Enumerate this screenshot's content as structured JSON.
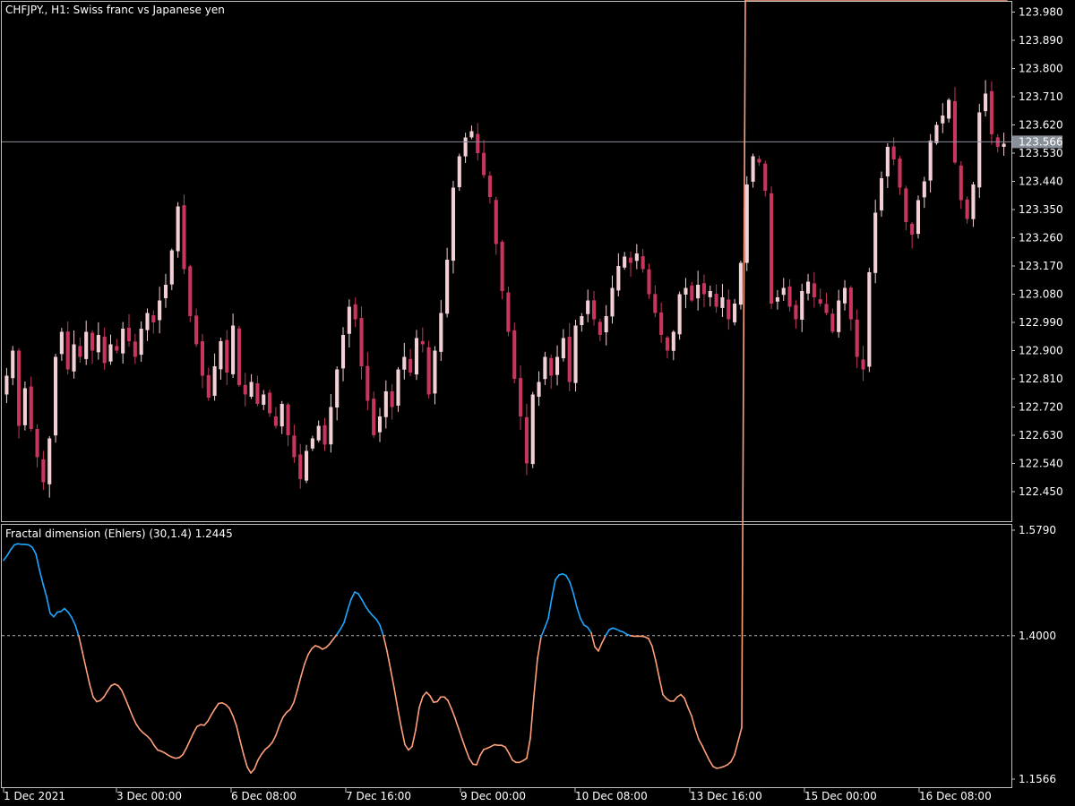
{
  "header": {
    "title": "CHFJPY., H1:  Swiss franc vs Japanese yen"
  },
  "indicator": {
    "title": "Fractal dimension (Ehlers) (30,1.4) 1.2445"
  },
  "colors": {
    "background": "#000000",
    "frame": "#c0c0c0",
    "bull_candle": "#f2d0d6",
    "bear_candle": "#c8365e",
    "price_line": "#8a9099",
    "price_label_bg": "#8a9099",
    "fd_above": "#1ea7ff",
    "fd_below": "#ff9f7a",
    "level_line": "#b8b8b8"
  },
  "chart_data": [
    {
      "type": "candlestick",
      "title": "CHFJPY., H1:  Swiss franc vs Japanese yen",
      "ylim": [
        122.39,
        123.99
      ],
      "y_ticks": [
        "123.980",
        "123.890",
        "123.800",
        "123.710",
        "123.620",
        "123.530",
        "123.440",
        "123.350",
        "123.260",
        "123.170",
        "123.080",
        "122.990",
        "122.900",
        "122.810",
        "122.720",
        "122.630",
        "122.540",
        "122.450"
      ],
      "current_price": "123.566",
      "x_ticks": [
        "1 Dec 2021",
        "3 Dec 00:00",
        "6 Dec 08:00",
        "7 Dec 16:00",
        "9 Dec 00:00",
        "10 Dec 08:00",
        "13 Dec 16:00",
        "15 Dec 00:00",
        "16 Dec 08:00"
      ],
      "closes": [
        122.82,
        122.9,
        122.66,
        122.78,
        122.65,
        122.56,
        122.48,
        122.62,
        122.88,
        122.96,
        122.84,
        122.92,
        122.88,
        122.96,
        122.9,
        122.95,
        122.86,
        122.92,
        122.9,
        122.97,
        122.93,
        122.88,
        122.97,
        123.02,
        122.99,
        123.06,
        123.11,
        123.22,
        123.36,
        123.16,
        123.01,
        122.92,
        122.82,
        122.75,
        122.85,
        122.93,
        122.83,
        122.98,
        122.79,
        122.76,
        122.8,
        122.73,
        122.76,
        122.7,
        122.66,
        122.73,
        122.63,
        122.56,
        122.49,
        122.58,
        122.62,
        122.66,
        122.6,
        122.72,
        122.84,
        122.95,
        123.04,
        123.0,
        122.85,
        122.74,
        122.63,
        122.69,
        122.77,
        122.72,
        122.84,
        122.88,
        122.83,
        122.94,
        122.92,
        122.76,
        122.9,
        123.02,
        123.19,
        123.42,
        123.52,
        123.58,
        123.6,
        123.53,
        123.46,
        123.39,
        123.24,
        123.09,
        122.96,
        122.81,
        122.69,
        122.54,
        122.76,
        122.8,
        122.88,
        122.82,
        122.88,
        122.94,
        122.8,
        122.98,
        123.01,
        123.06,
        123.0,
        122.95,
        123.01,
        123.1,
        123.17,
        123.2,
        123.18,
        123.21,
        123.16,
        123.08,
        123.02,
        122.95,
        122.9,
        122.96,
        123.08,
        123.1,
        123.06,
        123.11,
        123.08,
        123.09,
        123.04,
        123.07,
        123.0,
        123.05,
        123.18,
        123.43,
        123.52,
        123.5,
        123.41,
        123.05,
        123.07,
        123.1,
        123.04,
        123.0,
        123.09,
        123.12,
        123.07,
        123.05,
        123.02,
        122.96,
        123.06,
        123.1,
        123.0,
        122.88,
        122.84,
        123.15,
        123.34,
        123.45,
        123.55,
        123.51,
        123.42,
        123.31,
        123.27,
        123.38,
        123.44,
        123.57,
        123.62,
        123.65,
        123.7,
        123.5,
        123.38,
        123.32,
        123.43,
        123.66,
        123.72,
        123.59,
        123.55,
        123.56
      ],
      "panel": "main"
    },
    {
      "type": "line",
      "title": "Fractal dimension (Ehlers) (30,1.4) 1.2445",
      "ylim": [
        1.1566,
        1.579
      ],
      "y_ticks": [
        "1.5790",
        "1.4000",
        "1.1566"
      ],
      "level": 1.4,
      "current_value": 1.2445,
      "x": [
        0,
        4,
        8,
        12,
        16,
        20,
        24,
        28,
        32,
        36,
        40,
        44,
        48,
        52,
        56,
        60,
        64,
        68,
        72,
        76,
        80,
        84,
        88,
        92,
        96,
        100,
        104,
        108,
        112,
        116,
        120,
        124,
        128,
        132,
        136,
        140,
        144,
        148,
        152,
        156,
        160,
        164,
        168,
        172,
        176,
        180,
        184,
        188,
        192,
        196,
        200,
        204,
        208,
        212,
        216,
        220,
        224,
        228,
        232,
        236,
        240,
        244,
        248,
        252,
        256,
        260,
        264,
        268,
        272,
        276,
        280,
        284,
        288,
        292,
        296,
        300,
        304,
        308,
        312,
        316,
        320,
        324,
        328,
        332,
        336,
        340,
        344,
        348,
        352,
        356,
        360,
        364,
        368,
        372,
        376,
        380,
        384,
        388,
        392,
        396,
        400,
        404,
        408,
        412,
        416,
        420,
        424,
        428,
        432,
        436,
        440,
        444,
        448,
        452,
        456,
        460,
        464,
        468,
        472,
        476,
        480,
        484,
        488,
        492,
        496,
        500,
        504,
        508,
        512,
        516,
        520,
        524,
        528,
        532,
        536,
        540,
        544,
        548,
        552,
        556,
        560,
        564,
        568,
        572,
        576,
        580,
        584,
        588,
        592,
        596,
        600,
        604,
        608,
        612,
        616,
        620,
        624,
        628,
        632,
        636,
        640,
        644,
        648,
        652,
        656,
        660,
        664,
        668,
        672,
        676,
        680,
        684,
        688,
        692,
        696,
        700,
        704,
        708,
        712,
        716,
        720,
        724,
        728,
        732,
        736,
        740,
        744,
        748,
        752,
        756,
        760,
        764,
        768,
        772,
        776,
        780,
        784,
        788,
        792,
        796,
        800,
        804,
        808,
        812,
        816,
        820,
        824,
        828,
        832,
        836,
        840,
        844,
        848,
        852,
        856,
        860,
        864,
        868,
        872,
        876,
        880,
        884,
        888,
        892,
        896,
        900,
        904,
        908,
        912,
        916,
        920,
        924,
        928,
        932,
        936,
        940,
        944,
        948,
        952,
        956,
        960,
        964,
        968,
        972,
        976,
        980,
        984,
        988,
        992,
        996,
        1000,
        1004,
        1008,
        1012,
        1016,
        1020,
        1024,
        1028,
        1032,
        1036,
        1040,
        1044,
        1048,
        1052,
        1056,
        1060,
        1064,
        1068,
        1072,
        1076,
        1080,
        1084,
        1088,
        1092,
        1096,
        1100,
        1104,
        1108,
        1112,
        1116,
        1120
      ],
      "values": [
        1.528,
        1.536,
        1.546,
        1.554,
        1.556,
        1.555,
        1.555,
        1.554,
        1.55,
        1.539,
        1.512,
        1.488,
        1.466,
        1.438,
        1.432,
        1.44,
        1.441,
        1.446,
        1.44,
        1.431,
        1.418,
        1.399,
        1.372,
        1.345,
        1.318,
        1.296,
        1.288,
        1.29,
        1.296,
        1.306,
        1.315,
        1.318,
        1.315,
        1.307,
        1.293,
        1.278,
        1.263,
        1.25,
        1.241,
        1.235,
        1.23,
        1.224,
        1.214,
        1.206,
        1.204,
        1.201,
        1.197,
        1.194,
        1.192,
        1.193,
        1.198,
        1.209,
        1.222,
        1.235,
        1.246,
        1.249,
        1.248,
        1.255,
        1.266,
        1.276,
        1.285,
        1.286,
        1.283,
        1.277,
        1.264,
        1.247,
        1.222,
        1.198,
        1.177,
        1.167,
        1.174,
        1.189,
        1.199,
        1.207,
        1.212,
        1.219,
        1.231,
        1.248,
        1.262,
        1.27,
        1.275,
        1.287,
        1.308,
        1.331,
        1.352,
        1.368,
        1.378,
        1.383,
        1.381,
        1.377,
        1.38,
        1.386,
        1.394,
        1.402,
        1.411,
        1.422,
        1.443,
        1.462,
        1.474,
        1.471,
        1.461,
        1.45,
        1.441,
        1.434,
        1.428,
        1.418,
        1.4,
        1.374,
        1.343,
        1.311,
        1.276,
        1.244,
        1.215,
        1.206,
        1.212,
        1.24,
        1.278,
        1.297,
        1.304,
        1.298,
        1.287,
        1.288,
        1.296,
        1.296,
        1.29,
        1.276,
        1.26,
        1.242,
        1.224,
        1.207,
        1.191,
        1.182,
        1.181,
        1.197,
        1.207,
        1.209,
        1.212,
        1.215,
        1.214,
        1.214,
        1.211,
        1.201,
        1.189,
        1.185,
        1.185,
        1.188,
        1.192,
        1.226,
        1.298,
        1.361,
        1.398,
        1.413,
        1.429,
        1.464,
        1.495,
        1.503,
        1.505,
        1.502,
        1.491,
        1.472,
        1.448,
        1.429,
        1.418,
        1.414,
        1.405,
        1.381,
        1.374,
        1.388,
        1.4,
        1.41,
        1.413,
        1.411,
        1.408,
        1.406,
        1.402,
        1.4,
        1.399,
        1.399,
        1.399,
        1.398,
        1.395,
        1.382,
        1.357,
        1.328,
        1.3,
        1.293,
        1.289,
        1.289,
        1.296,
        1.3,
        1.294,
        1.278,
        1.264,
        1.242,
        1.224,
        1.213,
        1.2,
        1.188,
        1.178,
        1.175,
        1.176,
        1.178,
        1.181,
        1.186,
        1.198,
        1.221,
        1.244
      ]
    }
  ]
}
